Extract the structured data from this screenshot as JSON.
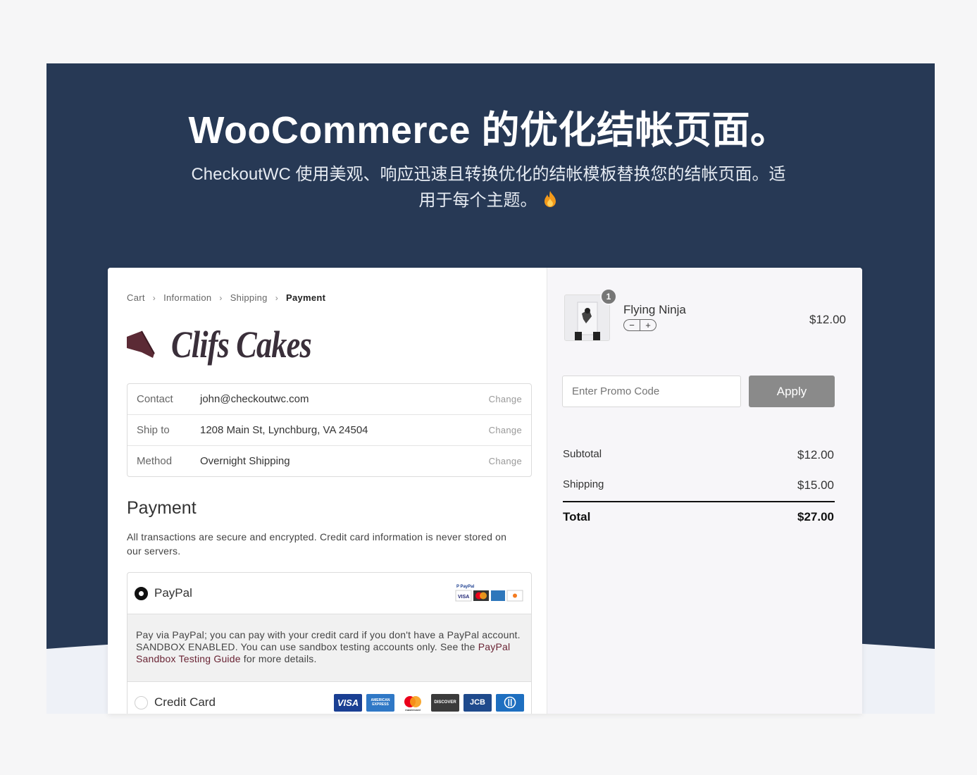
{
  "hero": {
    "headline": "WooCommerce 的优化结帐页面。",
    "subline_1": "CheckoutWC 使用美观、响应迅速且转换优化的结帐模板替换您的结帐页面。适",
    "subline_2": "用于每个主题。",
    "fire_icon": "fire-emoji",
    "colors": {
      "background": "#273955",
      "text": "#ffffff"
    }
  },
  "breadcrumb": {
    "items": [
      "Cart",
      "Information",
      "Shipping",
      "Payment"
    ],
    "current": "Payment"
  },
  "brand": {
    "name": "Clifs Cakes",
    "logo_icon": "cake-slice-icon",
    "color": "#5b2a35"
  },
  "review": {
    "rows": [
      {
        "label": "Contact",
        "value": "john@checkoutwc.com",
        "action": "Change"
      },
      {
        "label": "Ship to",
        "value": "1208 Main St, Lynchburg, VA 24504",
        "action": "Change"
      },
      {
        "label": "Method",
        "value": "Overnight Shipping",
        "action": "Change"
      }
    ]
  },
  "payment": {
    "title": "Payment",
    "description": "All transactions are secure and encrypted. Credit card information is never stored on our servers.",
    "methods": [
      {
        "label": "PayPal",
        "selected": true
      },
      {
        "label": "Credit Card",
        "selected": false
      }
    ],
    "paypal_info_before": "Pay via PayPal; you can pay with your credit card if you don't have a PayPal account. SANDBOX ENABLED. You can use sandbox testing accounts only. See the ",
    "paypal_info_link": "PayPal Sandbox Testing Guide",
    "paypal_info_after": " for more details.",
    "card_brands": [
      "VISA",
      "AMERICAN EXPRESS",
      "mastercard",
      "DISCOVER",
      "JCB",
      "Diners"
    ]
  },
  "cart": {
    "item": {
      "name": "Flying Ninja",
      "quantity": "1",
      "price": "$12.00",
      "minus": "−",
      "plus": "+"
    },
    "promo": {
      "placeholder": "Enter Promo Code",
      "button": "Apply"
    },
    "totals": {
      "subtotal_label": "Subtotal",
      "subtotal": "$12.00",
      "shipping_label": "Shipping",
      "shipping": "$15.00",
      "total_label": "Total",
      "total": "$27.00"
    }
  }
}
